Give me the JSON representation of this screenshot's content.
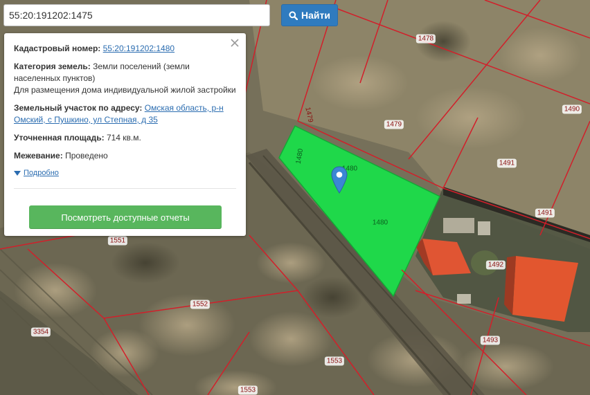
{
  "search": {
    "query": "55:20:191202:1475",
    "button_label": "Найти"
  },
  "popup": {
    "cadastral_label": "Кадастровый номер:",
    "cadastral_number": "55:20:191202:1480",
    "category_label": "Категория земель:",
    "category_value": "Земли поселений (земли населенных пунктов)",
    "category_usage": "Для размещения дома индивидуальной жилой застройки",
    "address_label": "Земельный участок по адресу:",
    "address_value": "Омская область, р-н Омский, с Пушкино, ул Степная, д 35",
    "area_label": "Уточненная площадь:",
    "area_value": "714 кв.м.",
    "survey_label": "Межевание:",
    "survey_value": "Проведено",
    "more_link": "Подробно",
    "reports_button": "Посмотреть доступные отчеты"
  },
  "parcels": {
    "p1478": "1478",
    "p1479": "1479",
    "p1479_side": "1479",
    "p1480_side": "1480",
    "p1480_center": "1480",
    "p1480_top": "1480",
    "p1490": "1490",
    "p1491_a": "1491",
    "p1491_b": "1491",
    "p1492": "1492",
    "p1493": "1493",
    "p1551": "1551",
    "p1552": "1552",
    "p1553_a": "1553",
    "p1553_b": "1553",
    "p3354": "3354"
  },
  "colors": {
    "selected_parcel": "#1fd84a",
    "boundary": "#d21f2a",
    "marker": "#3b86d4",
    "search_button": "#2f7bbf",
    "reports_button": "#58b65d"
  }
}
